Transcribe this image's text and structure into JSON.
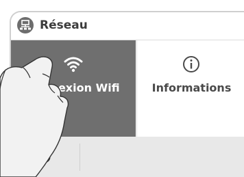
{
  "header": {
    "title": "Réseau",
    "icon": "network-icon"
  },
  "tiles": [
    {
      "label": "Connexion Wifi",
      "icon": "wifi-icon",
      "state": "pressed"
    },
    {
      "label": "Informations",
      "icon": "info-icon"
    }
  ],
  "footer": {
    "back_icon": "back-arrow-icon"
  },
  "overlay": {
    "icon": "tapping-hand-icon"
  },
  "colors": {
    "header_bg": "#ffffff",
    "selected_tile_bg": "#6f6f6f",
    "footer_bg": "#e8e8e8",
    "text_dark": "#3c3c3c"
  }
}
